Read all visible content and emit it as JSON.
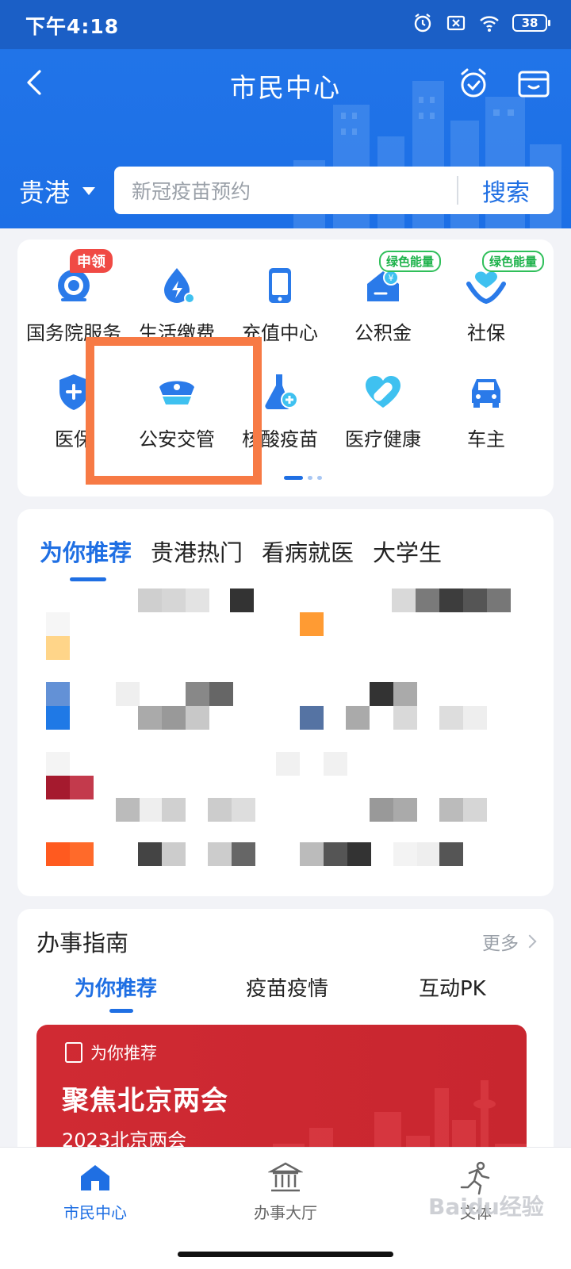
{
  "status_bar": {
    "time": "下午4:18",
    "battery": "38"
  },
  "header": {
    "title": "市民中心",
    "city": "贵港",
    "search_placeholder": "新冠疫苗预约",
    "search_button": "搜索"
  },
  "services": [
    {
      "label": "国务院服务",
      "icon": "state-council-icon",
      "badge": "申领"
    },
    {
      "label": "生活缴费",
      "icon": "utility-payment-icon"
    },
    {
      "label": "充值中心",
      "icon": "recharge-icon"
    },
    {
      "label": "公积金",
      "icon": "housing-fund-icon",
      "badge": "绿色能量"
    },
    {
      "label": "社保",
      "icon": "social-security-icon",
      "badge": "绿色能量"
    },
    {
      "label": "医保",
      "icon": "medical-insurance-icon"
    },
    {
      "label": "公安交管",
      "icon": "police-traffic-icon"
    },
    {
      "label": "核酸疫苗",
      "icon": "nucleic-vaccine-icon"
    },
    {
      "label": "医疗健康",
      "icon": "healthcare-icon"
    },
    {
      "label": "车主",
      "icon": "car-owner-icon"
    }
  ],
  "recommend": {
    "tabs": [
      "为你推荐",
      "贵港热门",
      "看病就医",
      "大学生"
    ],
    "active_tab": 0
  },
  "guide": {
    "title": "办事指南",
    "more": "更多",
    "tabs": [
      "为你推荐",
      "疫苗疫情",
      "互动PK"
    ],
    "banner": {
      "tag": "为你推荐",
      "headline": "聚焦北京两会",
      "subtitle": "2023北京两会"
    }
  },
  "bottom_nav": [
    {
      "label": "市民中心",
      "icon": "home-icon",
      "active": true
    },
    {
      "label": "办事大厅",
      "icon": "government-hall-icon",
      "active": false
    },
    {
      "label": "文体",
      "icon": "sports-icon",
      "active": false
    }
  ],
  "watermark": "Baidu经验",
  "colors": {
    "primary": "#1f6fe3",
    "header": "#2174e8",
    "highlight": "#f77a45",
    "banner": "#c8262f"
  }
}
